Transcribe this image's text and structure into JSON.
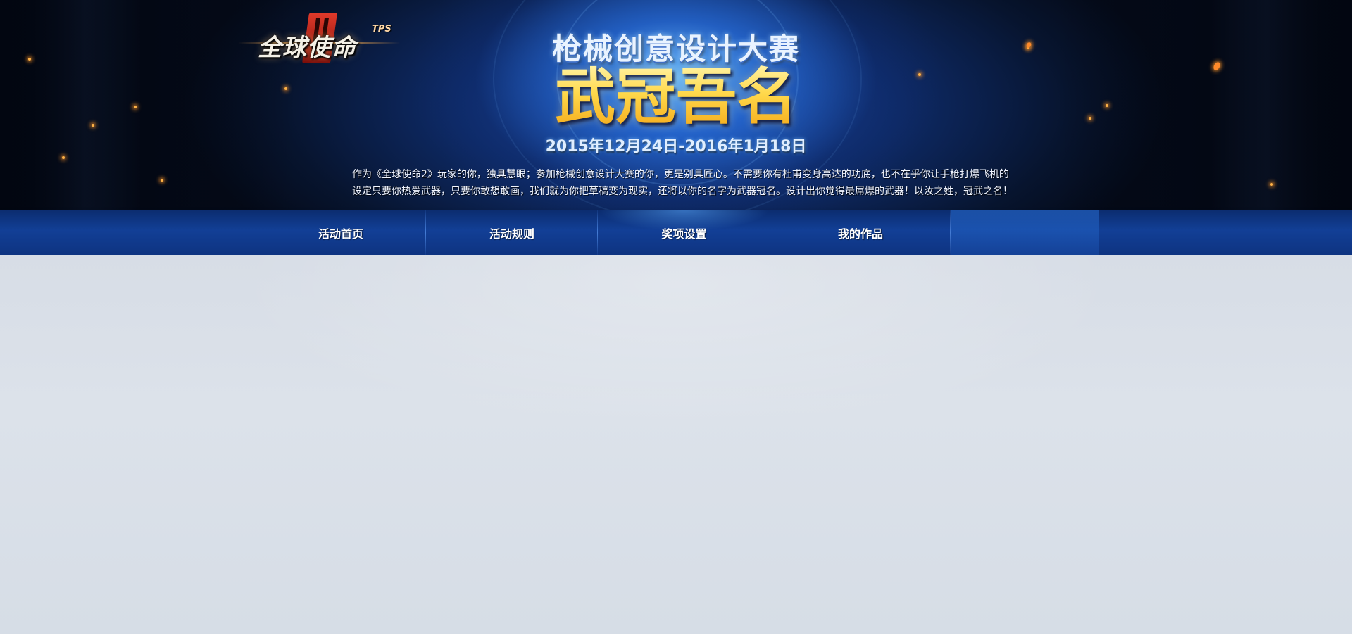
{
  "logo": {
    "text": "全球使命",
    "roman": "II",
    "tag": "TPS"
  },
  "banner": {
    "subtitle": "枪械创意设计大赛",
    "title": "武冠吾名",
    "date_range": "2015年12月24日-2016年1月18日",
    "intro_lines": [
      "作为《全球使命2》玩家的你，独具慧眼；参加枪械创意设计大赛的你，更是别具匠心。不需要你有杜甫变身高达的功底，也不在乎你让手枪打爆飞机的",
      "设定只要你热爱武器，只要你敢想敢画，我们就为你把草稿变为现实，还将以你的名字为武器冠名。设计出你觉得最屌爆的武器！以汝之姓，冠武之名！"
    ]
  },
  "nav": {
    "items": [
      {
        "label": "活动首页"
      },
      {
        "label": "活动规则"
      },
      {
        "label": "奖项设置"
      },
      {
        "label": "我的作品"
      },
      {
        "label": ""
      }
    ]
  },
  "colors": {
    "nav_bg": "#123f96",
    "accent_orange": "#f39a2f",
    "title_gold": "#ffd640",
    "content_bg": "#d7dde6"
  }
}
